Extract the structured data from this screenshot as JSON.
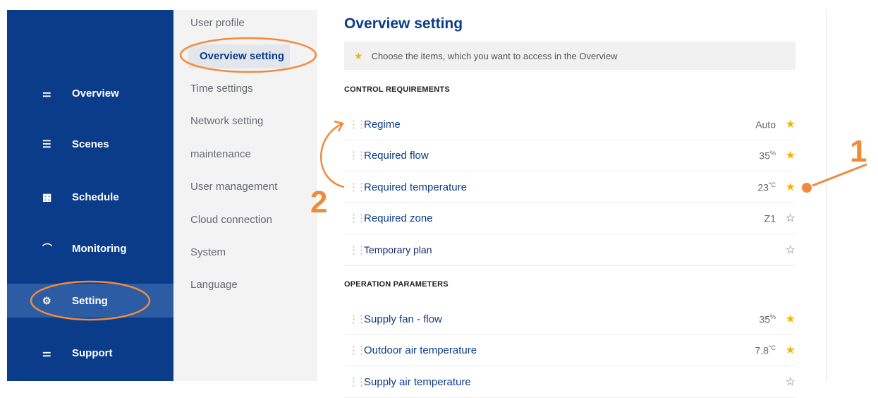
{
  "sidebar": {
    "items": [
      {
        "label": "Overview",
        "icon": "sliders-icon"
      },
      {
        "label": "Scenes",
        "icon": "list-indent-icon"
      },
      {
        "label": "Schedule",
        "icon": "calendar-icon"
      },
      {
        "label": "Monitoring",
        "icon": "gauge-icon"
      },
      {
        "label": "Setting",
        "icon": "gear-icon"
      },
      {
        "label": "Support",
        "icon": "sliders-icon"
      }
    ],
    "active": "Setting"
  },
  "submenu": {
    "items": [
      "User profile",
      "Overview setting",
      "Time settings",
      "Network setting",
      "maintenance",
      "User management",
      "Cloud connection",
      "System",
      "Language"
    ],
    "active": "Overview setting"
  },
  "main": {
    "title": "Overview setting",
    "banner": "Choose the items, which you want to access in the Overview",
    "sections": [
      {
        "title": "CONTROL REQUIREMENTS",
        "rows": [
          {
            "label": "Regime",
            "value": "Auto",
            "unit": "",
            "starred": true
          },
          {
            "label": "Required flow",
            "value": "35",
            "unit": "%",
            "starred": true
          },
          {
            "label": "Required temperature",
            "value": "23",
            "unit": "°C",
            "starred": true
          },
          {
            "label": "Required zone",
            "value": "Z1",
            "unit": "",
            "starred": false
          },
          {
            "label": "Temporary plan",
            "value": "",
            "unit": "",
            "starred": false
          }
        ]
      },
      {
        "title": "OPERATION PARAMETERS",
        "rows": [
          {
            "label": "Supply fan - flow",
            "value": "35",
            "unit": "%",
            "starred": true
          },
          {
            "label": "Outdoor air temperature",
            "value": "7.8",
            "unit": "°C",
            "starred": true
          },
          {
            "label": "Supply air temperature",
            "value": "",
            "unit": "",
            "starred": false
          }
        ]
      }
    ]
  },
  "annotations": {
    "label_1": "1",
    "label_2": "2",
    "color": "#f28a3c"
  },
  "colors": {
    "sidebar_bg": "#0a3c8a",
    "accent": "#0a3c8a",
    "star": "#f4b400",
    "annotation": "#f28a3c"
  }
}
